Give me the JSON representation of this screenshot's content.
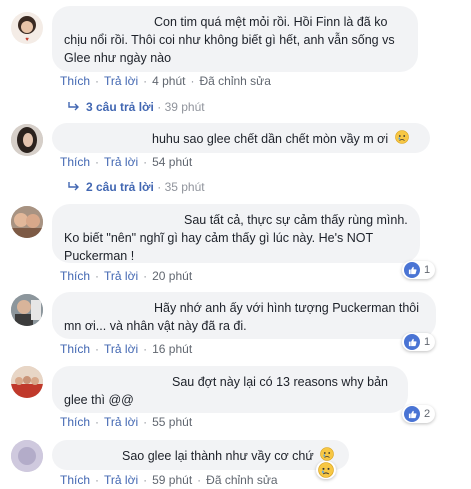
{
  "comments": [
    {
      "text": "Con tim quá mệt mỏi rồi. Hồi Finn là đã ko chịu nổi rồi. Thôi coi như không biết gì hết, anh vẫn sống vs Glee như ngày nào",
      "like": "Thích",
      "reply": "Trả lời",
      "time": "4 phút",
      "edited": "Đã chỉnh sửa",
      "replies_label": "3 câu trả lời",
      "replies_time": "39 phút"
    },
    {
      "text": "huhu sao glee chết dần chết mòn vầy m ơi",
      "like": "Thích",
      "reply": "Trả lời",
      "time": "54 phút",
      "reaction": "sad",
      "replies_label": "2 câu trả lời",
      "replies_time": "35 phút"
    },
    {
      "text": "Sau tất cả, thực sự cảm thấy rùng mình. Ko biết \"nên\" nghĩ gì hay cảm thấy gì lúc này. He's NOT Puckerman !",
      "like": "Thích",
      "reply": "Trả lời",
      "time": "20 phút",
      "reaction": "like",
      "reaction_count": "1"
    },
    {
      "text": "Hãy nhớ anh ấy với hình tượng Puckerman thôi mn ơi... và nhân vật này đã ra đi.",
      "like": "Thích",
      "reply": "Trả lời",
      "time": "16 phút",
      "reaction": "like",
      "reaction_count": "1"
    },
    {
      "text": "Sau đợt này lại có 13 reasons why bản glee thì @@",
      "like": "Thích",
      "reply": "Trả lời",
      "time": "55 phút",
      "reaction": "like",
      "reaction_count": "2"
    },
    {
      "text": "Sao glee lại thành như vầy cơ chứ",
      "like": "Thích",
      "reply": "Trả lời",
      "time": "59 phút",
      "edited": "Đã chỉnh sửa",
      "reaction": "sad"
    }
  ],
  "colors": {
    "link": "#4267b2",
    "meta": "#90949c",
    "bubble": "#f2f3f5",
    "like": "#4a74d4"
  }
}
